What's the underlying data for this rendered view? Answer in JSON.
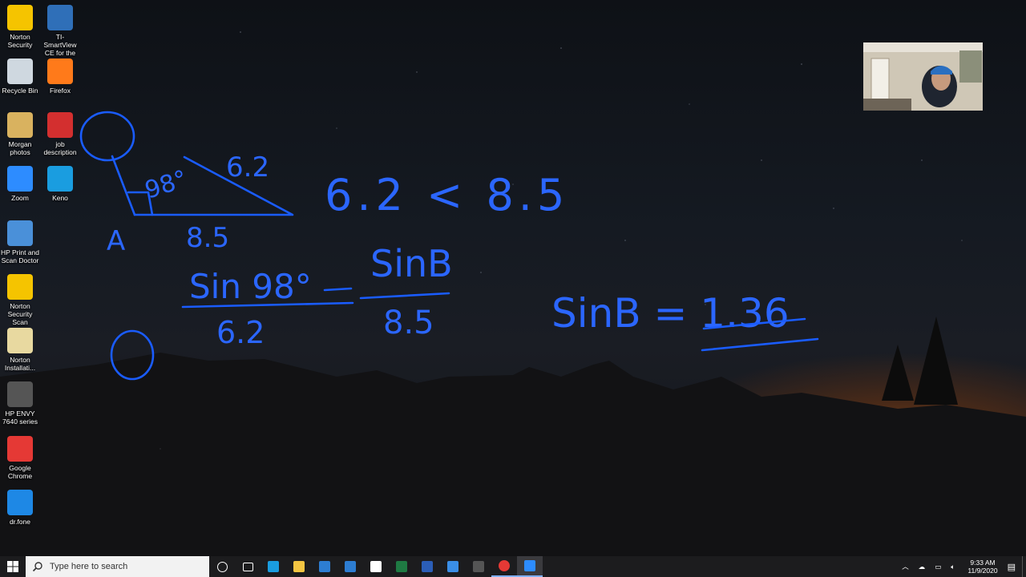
{
  "desktop_icons": [
    {
      "label": "Norton Security",
      "icon": "norton-check-icon",
      "color": "#f5c400"
    },
    {
      "label": "TI-SmartView CE for the T...",
      "icon": "ti-calculator-icon",
      "color": "#2f6fb8"
    },
    {
      "label": "Recycle Bin",
      "icon": "recycle-bin-icon",
      "color": "#cfd8e0"
    },
    {
      "label": "Firefox",
      "icon": "firefox-icon",
      "color": "#ff7a1a"
    },
    {
      "label": "Morgan photos",
      "icon": "folder-photos-icon",
      "color": "#d9b25f"
    },
    {
      "label": "job description",
      "icon": "pdf-icon",
      "color": "#d32f2f"
    },
    {
      "label": "Zoom",
      "icon": "zoom-icon",
      "color": "#2d8cff"
    },
    {
      "label": "Keno",
      "icon": "edge-icon",
      "color": "#1a9de0"
    },
    {
      "label": "HP Print and Scan Doctor",
      "icon": "hp-print-icon",
      "color": "#4a90d9"
    },
    {
      "label": "Norton Security Scan",
      "icon": "norton-scan-icon",
      "color": "#f5c400"
    },
    {
      "label": "Norton Installati...",
      "icon": "norton-installer-icon",
      "color": "#e8d9a0"
    },
    {
      "label": "HP ENVY 7640 series",
      "icon": "printer-icon",
      "color": "#555"
    },
    {
      "label": "Google Chrome",
      "icon": "chrome-icon",
      "color": "#e53935"
    },
    {
      "label": "dr.fone",
      "icon": "drfone-icon",
      "color": "#1e88e5"
    }
  ],
  "ink": {
    "vertex_label": "A",
    "angle_label": "98°",
    "side_top": "6.2",
    "side_bottom": "8.5",
    "inequality": "6.2 < 8.5",
    "eq_left_num": "Sin 98°",
    "eq_left_den": "6.2",
    "eq_right_num": "SinB",
    "eq_right_den": "8.5",
    "result": "SinB = 1.36"
  },
  "taskbar": {
    "search_placeholder": "Type here to search",
    "time": "9:33 AM",
    "date": "11/9/2020",
    "apps": [
      "cortana-circle-icon",
      "task-view-icon",
      "edge-icon",
      "file-explorer-icon",
      "store-icon",
      "mail-icon",
      "snip-icon",
      "excel-icon",
      "word-icon",
      "photos-icon",
      "ti-calculator-icon",
      "chrome-icon",
      "zoom-icon"
    ]
  },
  "colors": {
    "ink": "#1a5cff",
    "taskbar": "#1c1c1e"
  }
}
